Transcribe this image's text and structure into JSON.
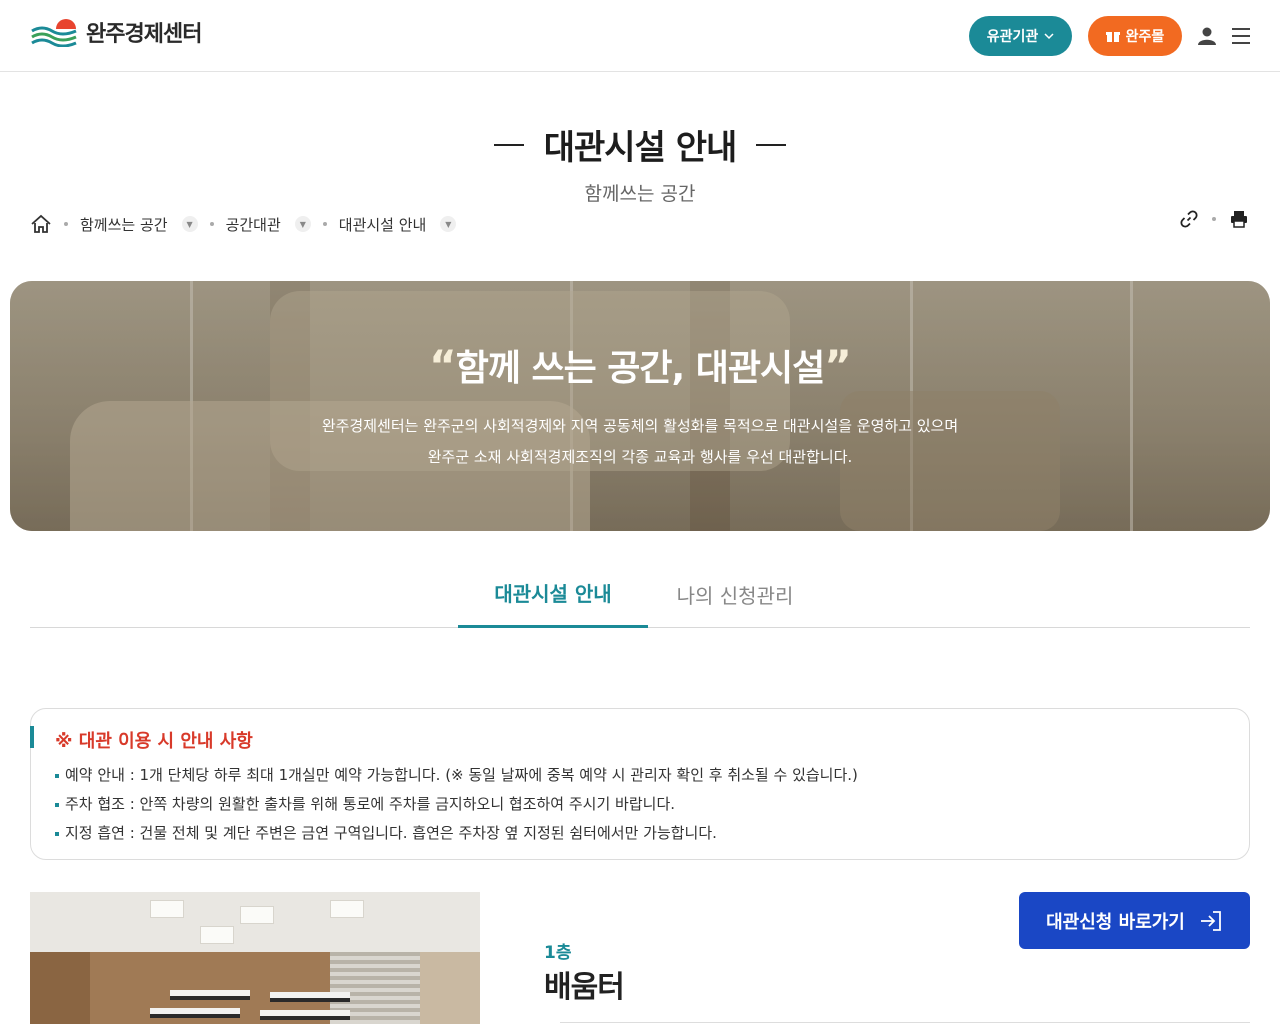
{
  "header": {
    "logo_text": "완주경제센터",
    "org_button": "유관기관",
    "mall_button": "완주몰"
  },
  "page": {
    "title": "대관시설 안내",
    "subtitle": "함께쓰는 공간"
  },
  "breadcrumb": {
    "items": [
      "함께쓰는 공간",
      "공간대관",
      "대관시설 안내"
    ]
  },
  "hero": {
    "quote_open": "“",
    "title": "함께 쓰는 공간, 대관시설",
    "quote_close": "”",
    "line1": "완주경제센터는 완주군의 사회적경제와 지역 공동체의 활성화를 목적으로 대관시설을 운영하고 있으며",
    "line2": "완주군 소재 사회적경제조직의 각종 교육과 행사를 우선 대관합니다."
  },
  "tabs": [
    {
      "label": "대관시설 안내",
      "active": true
    },
    {
      "label": "나의 신청관리",
      "active": false
    }
  ],
  "notice": {
    "title": "※ 대관 이용 시 안내 사항",
    "items": [
      "예약 안내 : 1개 단체당 하루 최대 1개실만 예약 가능합니다. (※ 동일 날짜에 중복 예약 시 관리자 확인 후 취소될 수 있습니다.)",
      "주차 협조 : 안쪽 차량의 원활한 출차를 위해 통로에 주차를 금지하오니 협조하여 주시기 바랍니다.",
      "지정 흡연 : 건물 전체 및 계단 주변은 금연 구역입니다. 흡연은 주차장 옆 지정된 쉼터에서만 가능합니다."
    ]
  },
  "facility": {
    "apply_button": "대관신청 바로가기",
    "floor": "1층",
    "room": "배움터"
  },
  "colors": {
    "teal": "#1b8a97",
    "orange": "#f26a21",
    "blue": "#1a47c5",
    "notice_red": "#d83a2a"
  }
}
